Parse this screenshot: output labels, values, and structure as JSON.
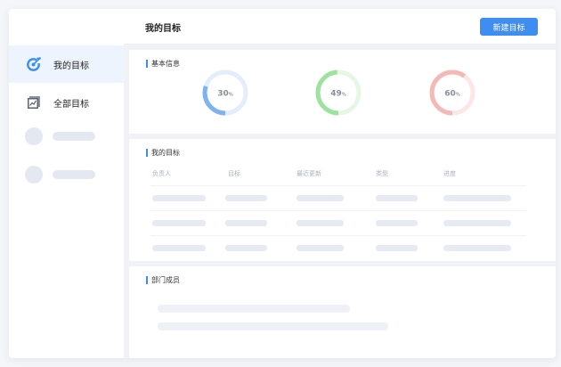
{
  "sidebar": {
    "items": [
      {
        "label": "我的目标",
        "icon": "target-icon",
        "active": true
      },
      {
        "label": "全部目标",
        "icon": "chart-board-icon",
        "active": false
      }
    ]
  },
  "header": {
    "title": "我的目标",
    "new_button": "新建目标"
  },
  "basic_info": {
    "title": "基本信息",
    "gauges": [
      {
        "value": 30,
        "label": "30",
        "unit": "%",
        "color": "#7fb2ef",
        "track": "#e4eefb"
      },
      {
        "value": 49,
        "label": "49",
        "unit": "%",
        "color": "#9de3a0",
        "track": "#e6f7e6"
      },
      {
        "value": 60,
        "label": "60",
        "unit": "%",
        "color": "#f3b9b7",
        "track": "#fbe7e6"
      }
    ]
  },
  "goals": {
    "title": "我的目标",
    "columns": [
      "负责人",
      "目标",
      "最近更新",
      "类型",
      "进度"
    ]
  },
  "members": {
    "title": "部门成员"
  },
  "colors": {
    "accent": "#3d8ef0",
    "active_bg": "#eef4fd"
  }
}
